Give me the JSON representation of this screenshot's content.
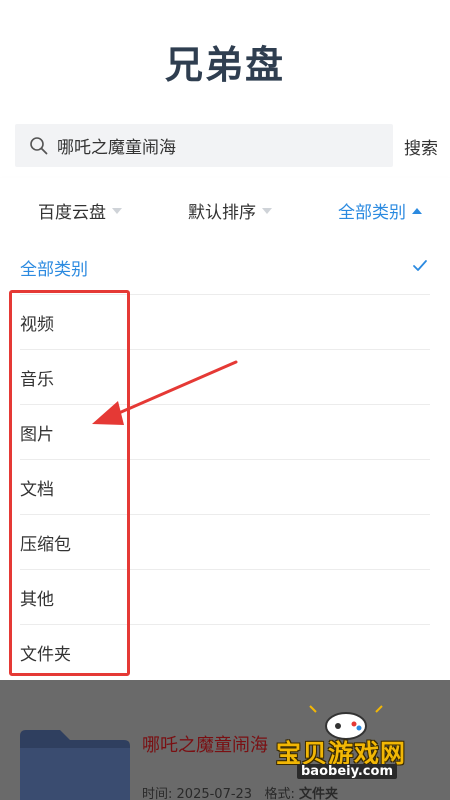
{
  "app": {
    "title": "兄弟盘"
  },
  "search": {
    "value": "哪吒之魔童闹海",
    "button_label": "搜索"
  },
  "filters": {
    "source": "百度云盘",
    "sort": "默认排序",
    "category": "全部类别",
    "accent_color": "#2b8ae0"
  },
  "dropdown": {
    "items": [
      {
        "label": "全部类别",
        "selected": true
      },
      {
        "label": "视频"
      },
      {
        "label": "音乐"
      },
      {
        "label": "图片"
      },
      {
        "label": "文档"
      },
      {
        "label": "压缩包"
      },
      {
        "label": "其他"
      },
      {
        "label": "文件夹"
      }
    ]
  },
  "annotation": {
    "box_color": "#e53935"
  },
  "result": {
    "name": "哪吒之魔童闹海",
    "meta_label_time": "时间:",
    "meta_time": "2025-07-23",
    "meta_label_format": "格式:",
    "meta_format": "文件夹"
  },
  "watermark": {
    "text": "宝贝游戏网",
    "sub": "baobeiy.com"
  }
}
